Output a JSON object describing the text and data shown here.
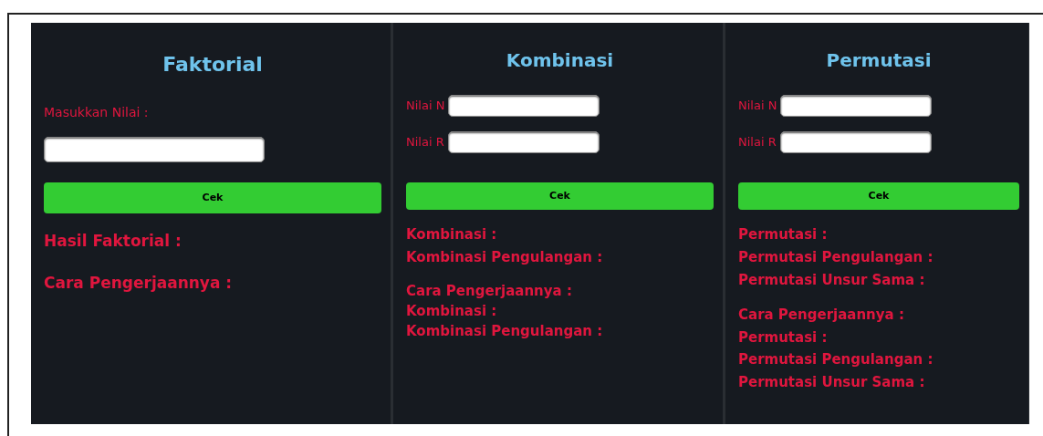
{
  "panels": [
    {
      "title": "Faktorial",
      "kind": "stacked",
      "fields": [
        {
          "label": "Masukkan Nilai :"
        }
      ],
      "button": "Cek",
      "results": [
        "Hasil Faktorial :"
      ],
      "working": [
        "Cara Pengerjaannya :"
      ]
    },
    {
      "title": "Kombinasi",
      "kind": "inline",
      "fields": [
        {
          "label": "Nilai N"
        },
        {
          "label": "Nilai R"
        }
      ],
      "button": "Cek",
      "results": [
        "Kombinasi :",
        "Kombinasi Pengulangan :"
      ],
      "working": [
        "Cara Pengerjaannya :",
        "Kombinasi :",
        "Kombinasi Pengulangan :"
      ]
    },
    {
      "title": "Permutasi",
      "kind": "inline",
      "fields": [
        {
          "label": "Nilai N"
        },
        {
          "label": "Nilai R"
        }
      ],
      "button": "Cek",
      "results": [
        "Permutasi :",
        "Permutasi Pengulangan :",
        "Permutasi Unsur Sama :"
      ],
      "working": [
        "Cara Pengerjaannya :",
        "Permutasi :",
        "Permutasi Pengulangan :",
        "Permutasi Unsur Sama :"
      ]
    }
  ]
}
